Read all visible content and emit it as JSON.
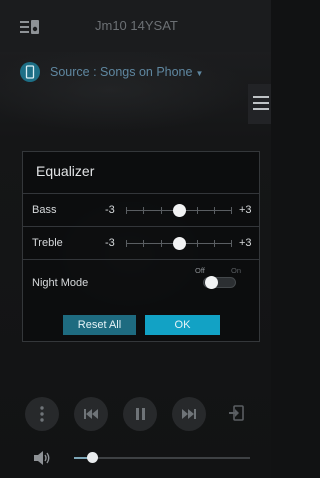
{
  "header": {
    "device_name": "Jm10 14YSAT",
    "speaker_icon": "speaker-list-icon"
  },
  "source": {
    "label": "Source : Songs on Phone",
    "icon": "phone-icon"
  },
  "menu_icon": "hamburger-menu-icon",
  "equalizer": {
    "title": "Equalizer",
    "bass": {
      "label": "Bass",
      "min": "-3",
      "max": "+3",
      "value": 0
    },
    "treble": {
      "label": "Treble",
      "min": "-3",
      "max": "+3",
      "value": 0
    },
    "night_mode": {
      "label": "Night Mode",
      "off_label": "Off",
      "on_label": "On",
      "enabled": false
    },
    "reset_label": "Reset All",
    "ok_label": "OK"
  },
  "transport": {
    "more_icon": "more-vertical-icon",
    "previous_icon": "skip-previous-icon",
    "pause_icon": "pause-icon",
    "next_icon": "skip-next-icon",
    "disconnect_icon": "exit-icon"
  },
  "volume": {
    "icon": "volume-icon",
    "level_percent": 10
  },
  "colors": {
    "accent": "#12a2c5",
    "reset_button": "#1e6b80",
    "source_text": "#5f87a0"
  }
}
